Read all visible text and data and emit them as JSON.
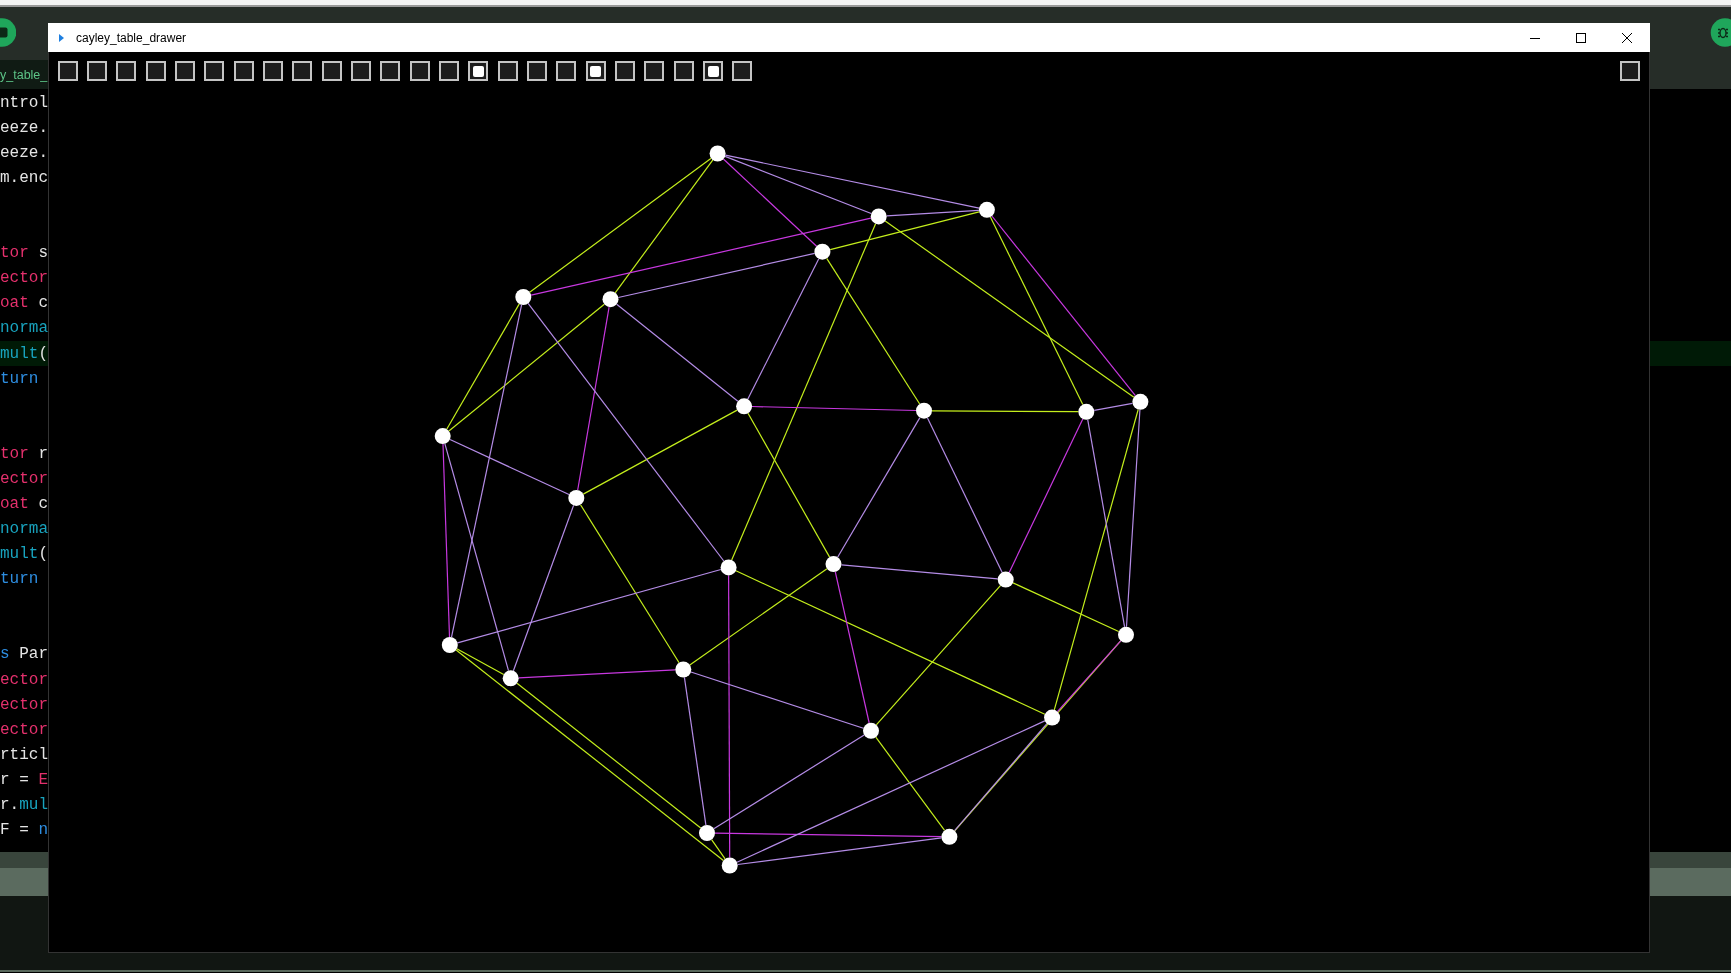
{
  "ide": {
    "tab_label": "y_table_",
    "code_blocks": [
      {
        "lines": [
          {
            "highlighted": false,
            "segments": [
              {
                "kind": "plain",
                "text": "ntrol"
              }
            ]
          },
          {
            "highlighted": false,
            "segments": [
              {
                "kind": "plain",
                "text": "eeze."
              }
            ]
          },
          {
            "highlighted": false,
            "segments": [
              {
                "kind": "plain",
                "text": "eeze."
              }
            ]
          },
          {
            "highlighted": false,
            "segments": [
              {
                "kind": "plain",
                "text": "m.enc"
              }
            ]
          }
        ]
      },
      {
        "lines": [
          {
            "highlighted": false,
            "segments": [
              {
                "kind": "type",
                "text": "tor"
              },
              {
                "kind": "plain",
                "text": " s"
              }
            ]
          },
          {
            "highlighted": false,
            "segments": [
              {
                "kind": "type",
                "text": "ector"
              }
            ]
          },
          {
            "highlighted": false,
            "segments": [
              {
                "kind": "type",
                "text": "oat"
              },
              {
                "kind": "plain",
                "text": " c"
              }
            ]
          },
          {
            "highlighted": false,
            "segments": [
              {
                "kind": "function",
                "text": "norma"
              }
            ]
          },
          {
            "highlighted": true,
            "segments": [
              {
                "kind": "function",
                "text": "mult"
              },
              {
                "kind": "plain",
                "text": "("
              }
            ]
          },
          {
            "highlighted": false,
            "segments": [
              {
                "kind": "keyword",
                "text": "turn"
              }
            ]
          }
        ]
      },
      {
        "lines": [
          {
            "highlighted": false,
            "segments": [
              {
                "kind": "type",
                "text": "tor"
              },
              {
                "kind": "plain",
                "text": " r"
              }
            ]
          },
          {
            "highlighted": false,
            "segments": [
              {
                "kind": "type",
                "text": "ector"
              }
            ]
          },
          {
            "highlighted": false,
            "segments": [
              {
                "kind": "type",
                "text": "oat"
              },
              {
                "kind": "plain",
                "text": " c"
              }
            ]
          },
          {
            "highlighted": false,
            "segments": [
              {
                "kind": "function",
                "text": "norma"
              }
            ]
          },
          {
            "highlighted": false,
            "segments": [
              {
                "kind": "function",
                "text": "mult"
              },
              {
                "kind": "plain",
                "text": "("
              }
            ]
          },
          {
            "highlighted": false,
            "segments": [
              {
                "kind": "keyword",
                "text": "turn"
              }
            ]
          }
        ]
      },
      {
        "lines": [
          {
            "highlighted": false,
            "segments": [
              {
                "kind": "keyword",
                "text": "s"
              },
              {
                "kind": "plain",
                "text": " Par"
              }
            ]
          },
          {
            "highlighted": false,
            "segments": [
              {
                "kind": "type",
                "text": "ector"
              }
            ]
          },
          {
            "highlighted": false,
            "segments": [
              {
                "kind": "type",
                "text": "ector"
              }
            ]
          },
          {
            "highlighted": false,
            "segments": [
              {
                "kind": "type",
                "text": "ector"
              }
            ]
          },
          {
            "highlighted": false,
            "segments": [
              {
                "kind": "plain",
                "text": "rticl"
              }
            ]
          },
          {
            "highlighted": false,
            "segments": [
              {
                "kind": "plain",
                "text": "r = "
              },
              {
                "kind": "type",
                "text": "E"
              }
            ]
          },
          {
            "highlighted": false,
            "segments": [
              {
                "kind": "plain",
                "text": "r."
              },
              {
                "kind": "function",
                "text": "mul"
              }
            ]
          },
          {
            "highlighted": false,
            "segments": [
              {
                "kind": "plain",
                "text": "F = "
              },
              {
                "kind": "keyword",
                "text": "n"
              }
            ]
          }
        ]
      }
    ]
  },
  "window": {
    "title": "cayley_table_drawer",
    "checkboxes": [
      {
        "checked": false
      },
      {
        "checked": false
      },
      {
        "checked": false
      },
      {
        "checked": false
      },
      {
        "checked": false
      },
      {
        "checked": false
      },
      {
        "checked": false
      },
      {
        "checked": false
      },
      {
        "checked": false
      },
      {
        "checked": false
      },
      {
        "checked": false
      },
      {
        "checked": false
      },
      {
        "checked": false
      },
      {
        "checked": false
      },
      {
        "checked": true
      },
      {
        "checked": false
      },
      {
        "checked": false
      },
      {
        "checked": false
      },
      {
        "checked": true
      },
      {
        "checked": false
      },
      {
        "checked": false
      },
      {
        "checked": false
      },
      {
        "checked": true
      },
      {
        "checked": false
      }
    ],
    "corner_checkbox": {
      "checked": false
    },
    "graph": {
      "edges": [
        {
          "color": "#c4ee1c"
        },
        {
          "color": "#c4ee1c"
        },
        {
          "color": "#c4ee1c"
        },
        {
          "color": "#c4ee1c"
        },
        {
          "color": "#c4ee1c"
        },
        {
          "color": "#c4ee1c"
        },
        {
          "color": "#c4ee1c"
        },
        {
          "color": "#c4ee1c"
        },
        {
          "color": "#c4ee1c"
        },
        {
          "color": "#c4ee1c"
        },
        {
          "color": "#c4ee1c"
        },
        {
          "color": "#c4ee1c"
        },
        {
          "color": "#c4ee1c"
        },
        {
          "color": "#c4ee1c"
        },
        {
          "color": "#c4ee1c"
        },
        {
          "color": "#c4ee1c"
        },
        {
          "color": "#c4ee1c"
        },
        {
          "color": "#c4ee1c"
        },
        {
          "color": "#c4ee1c"
        },
        {
          "color": "#c4ee1c"
        },
        {
          "color": "#c4ee1c"
        },
        {
          "color": "#c4ee1c"
        },
        {
          "color": "#c4ee1c"
        },
        {
          "color": "#c4ee1c"
        },
        {
          "color": "#c838e0"
        },
        {
          "color": "#c838e0"
        },
        {
          "color": "#c838e0"
        },
        {
          "color": "#c838e0"
        },
        {
          "color": "#c838e0"
        },
        {
          "color": "#c838e0"
        },
        {
          "color": "#c838e0"
        },
        {
          "color": "#c838e0"
        },
        {
          "color": "#c838e0"
        },
        {
          "color": "#c838e0"
        },
        {
          "color": "#c838e0"
        },
        {
          "color": "#c838e0"
        },
        {
          "color": "#b48ce6"
        },
        {
          "color": "#b48ce6"
        },
        {
          "color": "#b48ce6"
        },
        {
          "color": "#b48ce6"
        },
        {
          "color": "#b48ce6"
        },
        {
          "color": "#b48ce6"
        },
        {
          "color": "#b48ce6"
        },
        {
          "color": "#b48ce6"
        },
        {
          "color": "#b48ce6"
        },
        {
          "color": "#b48ce6"
        },
        {
          "color": "#b48ce6"
        },
        {
          "color": "#b48ce6"
        },
        {
          "color": "#b48ce6"
        },
        {
          "color": "#b48ce6"
        },
        {
          "color": "#b48ce6"
        },
        {
          "color": "#b48ce6"
        },
        {
          "color": "#b48ce6"
        },
        {
          "color": "#b48ce6"
        },
        {
          "color": "#b48ce6"
        },
        {
          "color": "#b48ce6"
        },
        {
          "color": "#b48ce6"
        },
        {
          "color": "#b48ce6"
        },
        {
          "color": "#b48ce6"
        },
        {
          "color": "#b48ce6"
        }
      ]
    }
  }
}
